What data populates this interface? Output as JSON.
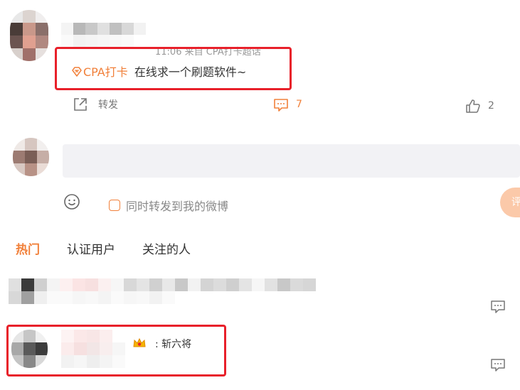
{
  "post": {
    "meta": "11:06 来自 CPA打卡超话",
    "tag": "CPA打卡",
    "text": "在线求一个刷题软件~"
  },
  "actions": {
    "repost_label": "转发",
    "comments_count": "7",
    "likes_count": "2"
  },
  "compose": {
    "repost_checkbox_label": "同时转发到我的微博",
    "submit_label": "评"
  },
  "tabs": [
    {
      "label": "热门",
      "active": true
    },
    {
      "label": "认证用户",
      "active": false
    },
    {
      "label": "关注的人",
      "active": false
    }
  ],
  "comments": [
    {
      "name": "",
      "text": ""
    },
    {
      "name": "斩六将",
      "text": ""
    }
  ],
  "colors": {
    "accent": "#f1803a",
    "highlight_box": "#e8202a",
    "compose_bg": "#f2f2f5"
  },
  "icons": {
    "repost": "share-out-icon",
    "comment": "comment-icon",
    "like": "thumb-up-icon",
    "emoji": "smile-icon",
    "tag": "super-topic-icon",
    "reply": "reply-comment-icon",
    "badge": "crown-icon"
  }
}
